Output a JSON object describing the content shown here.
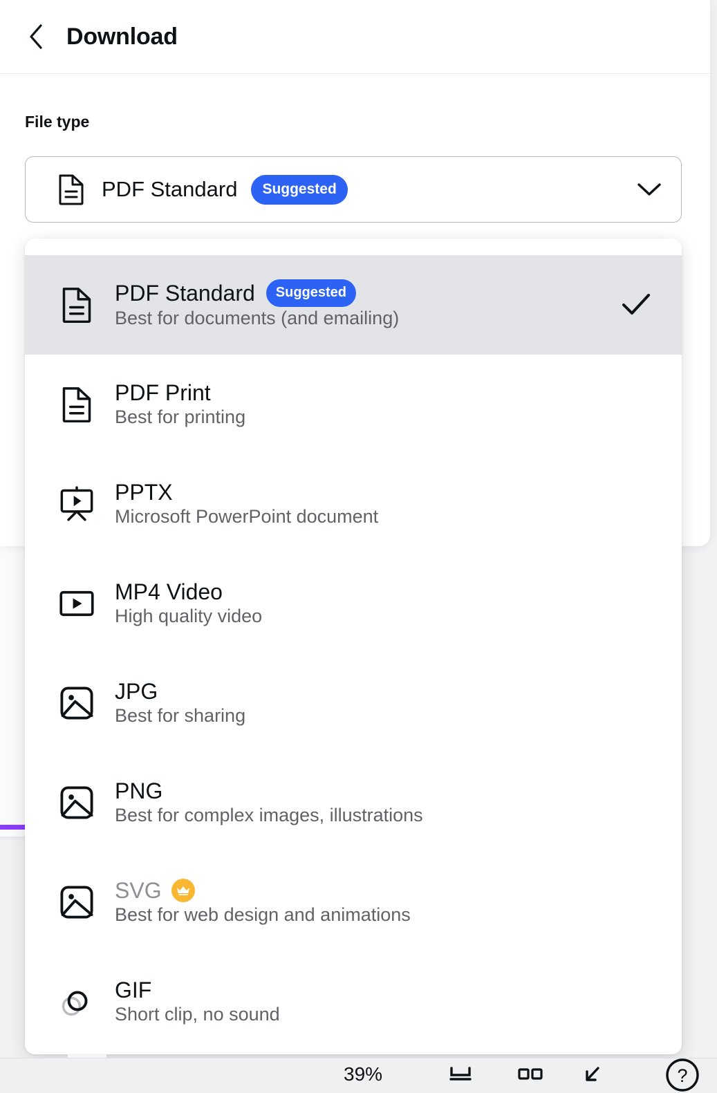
{
  "header": {
    "back_icon": "chevron-left-icon",
    "title": "Download"
  },
  "file_type_section": {
    "label": "File type",
    "select": {
      "icon": "pdf-file-icon",
      "value": "PDF Standard",
      "badge": "Suggested",
      "chevron_icon": "chevron-down-icon"
    }
  },
  "dropdown": {
    "options": [
      {
        "icon": "pdf-file-icon",
        "title": "PDF Standard",
        "badge": "Suggested",
        "desc": "Best for documents (and emailing)",
        "selected": true,
        "locked": false
      },
      {
        "icon": "pdf-file-icon",
        "title": "PDF Print",
        "badge": "",
        "desc": "Best for printing",
        "selected": false,
        "locked": false
      },
      {
        "icon": "presentation-icon",
        "title": "PPTX",
        "badge": "",
        "desc": "Microsoft PowerPoint document",
        "selected": false,
        "locked": false
      },
      {
        "icon": "video-icon",
        "title": "MP4 Video",
        "badge": "",
        "desc": "High quality video",
        "selected": false,
        "locked": false
      },
      {
        "icon": "image-icon",
        "title": "JPG",
        "badge": "",
        "desc": "Best for sharing",
        "selected": false,
        "locked": false
      },
      {
        "icon": "image-icon",
        "title": "PNG",
        "badge": "",
        "desc": "Best for complex images, illustrations",
        "selected": false,
        "locked": false
      },
      {
        "icon": "image-icon",
        "title": "SVG",
        "badge": "",
        "desc": "Best for web design and animations",
        "selected": false,
        "locked": true,
        "crown_icon": "crown-icon"
      },
      {
        "icon": "gif-circles-icon",
        "title": "GIF",
        "badge": "",
        "desc": "Short clip, no sound",
        "selected": false,
        "locked": false
      }
    ],
    "check_icon": "check-icon"
  },
  "bottom_bar": {
    "zoom": "39%",
    "notes_icon": "notes-panel-icon",
    "grid_icon": "grid-view-icon",
    "fullscreen_icon": "collapse-arrow-icon",
    "help_icon": "help-question-icon"
  },
  "colors": {
    "accent_blue": "#2c63f5",
    "crown_yellow": "#f7b731",
    "selected_row": "#e2e4e7",
    "purple_rule": "#8b3dff",
    "text_primary": "#0d1216",
    "text_muted": "#5f6368",
    "text_disabled": "#8b9096"
  }
}
